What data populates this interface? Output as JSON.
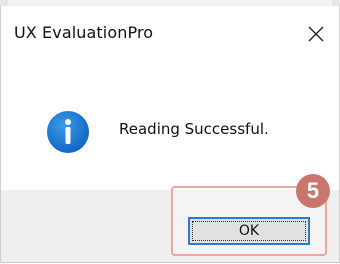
{
  "dialog": {
    "title": "UX EvaluationPro",
    "close_icon": "close-icon",
    "icon": "info-icon",
    "message": "Reading Successful.",
    "ok_label": "OK"
  },
  "annotation": {
    "step_number": "5",
    "badge_color": "#c9766e",
    "highlight_color": "#e7a9a1"
  },
  "colors": {
    "info_blue": "#0078d7",
    "button_focus_border": "#2b7bd4",
    "footer_bg": "#efefef"
  }
}
